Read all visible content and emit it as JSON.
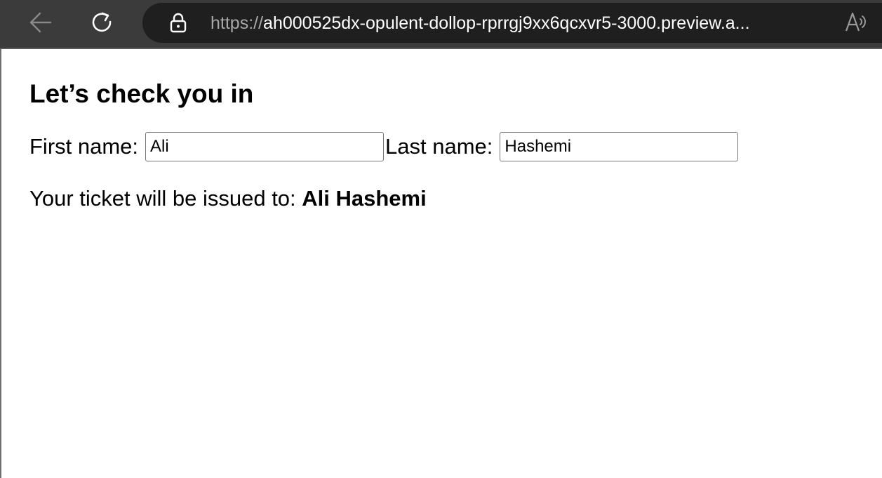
{
  "browser": {
    "url_scheme": "https://",
    "url_rest": "ah000525dx-opulent-dollop-rprrgj9xx6qcxvr5-3000.preview.a..."
  },
  "page": {
    "title": "Let’s check you in",
    "first_name_label": "First name:",
    "first_name_value": "Ali",
    "last_name_label": "Last name:",
    "last_name_value": "Hashemi",
    "ticket_prefix": "Your ticket will be issued to: ",
    "ticket_name": "Ali Hashemi"
  },
  "icons": {
    "back": "back-arrow-icon",
    "reload": "reload-icon",
    "lock": "lock-icon",
    "read_aloud": "read-aloud-icon"
  }
}
